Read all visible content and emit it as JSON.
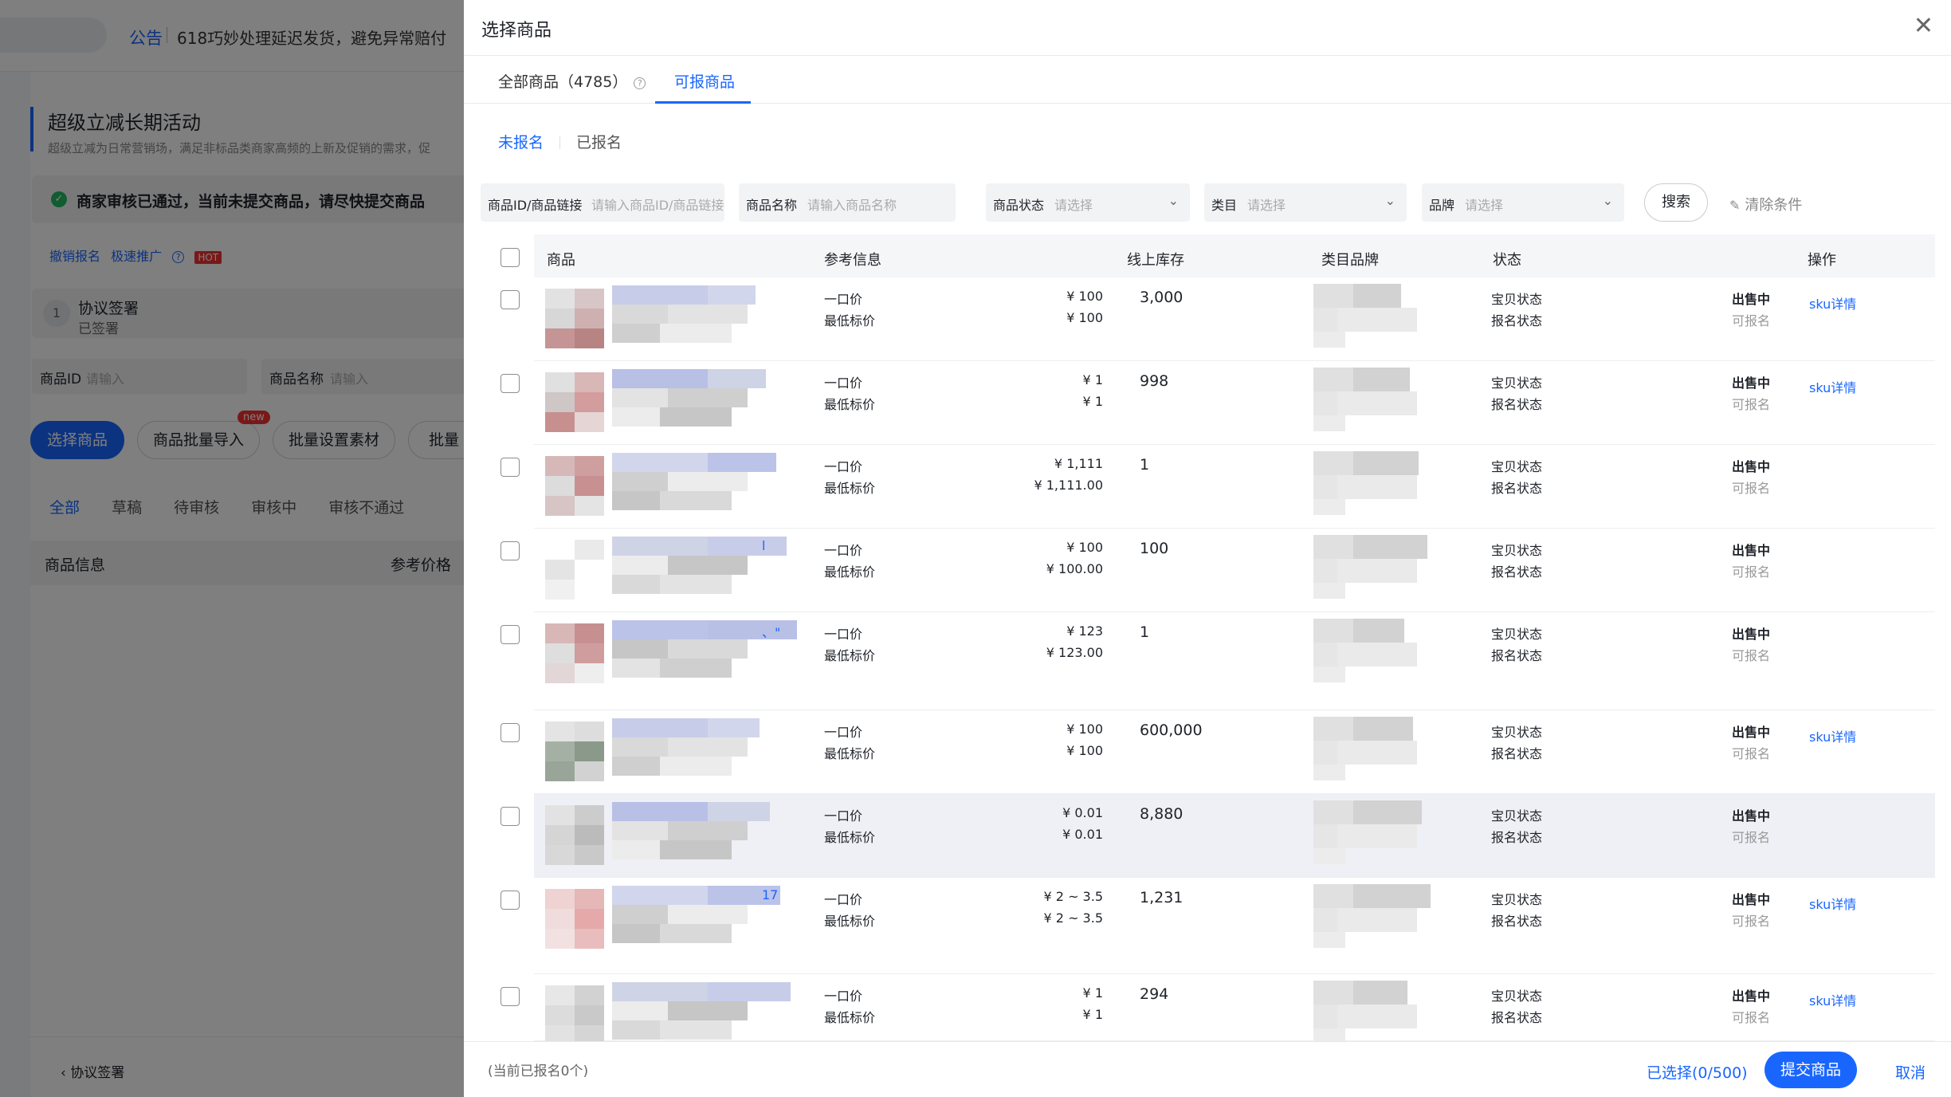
{
  "background": {
    "notice_tag": "公告",
    "notice_text": "618巧妙处理延迟发货，避免异常赔付",
    "activity_title": "超级立减长期活动",
    "activity_desc": "超级立减为日常营销场，满足非标品类商家高频的上新及促销的需求，促",
    "status_text": "商家审核已通过，当前未提交商品，请尽快提交商品",
    "links": [
      "撤销报名",
      "极速推广"
    ],
    "hot_badge": "HOT",
    "step": {
      "num": "1",
      "title": "协议签署",
      "subtitle": "已签署"
    },
    "fields": [
      {
        "label": "商品ID",
        "placeholder": "请输入"
      },
      {
        "label": "商品名称",
        "placeholder": "请输入"
      }
    ],
    "buttons": [
      "选择商品",
      "商品批量导入",
      "批量设置素材",
      "批量"
    ],
    "new_badge": "new",
    "tabs": [
      "全部",
      "草稿",
      "待审核",
      "审核中",
      "审核不通过"
    ],
    "table_headers": [
      "商品信息",
      "参考价格"
    ],
    "footer_back": "协议签署"
  },
  "drawer": {
    "title": "选择商品",
    "tabs": [
      {
        "label": "全部商品（4785）",
        "active": false
      },
      {
        "label": "可报商品",
        "active": true
      }
    ],
    "subtabs": [
      {
        "label": "未报名",
        "active": true
      },
      {
        "label": "已报名",
        "active": false
      }
    ],
    "filters": [
      {
        "label": "商品ID/商品链接",
        "placeholder": "请输入商品ID/商品链接"
      },
      {
        "label": "商品名称",
        "placeholder": "请输入商品名称"
      },
      {
        "label": "商品状态",
        "placeholder": "请选择"
      },
      {
        "label": "类目",
        "placeholder": "请选择"
      },
      {
        "label": "品牌",
        "placeholder": "请选择"
      }
    ],
    "search_label": "搜索",
    "clear_label": "清除条件",
    "columns": [
      "商品",
      "参考信息",
      "线上库存",
      "类目品牌",
      "状态",
      "操作"
    ],
    "price_label": "一口价",
    "lowest_label": "最低标价",
    "status_label_1": "宝贝状态",
    "status_label_2": "报名状态",
    "rows": [
      {
        "price": "¥ 100",
        "lowest": "¥ 100",
        "stock": "3,000",
        "status1": "出售中",
        "status2": "可报名",
        "op": "sku详情"
      },
      {
        "price": "¥ 1",
        "lowest": "¥ 1",
        "stock": "998",
        "status1": "出售中",
        "status2": "可报名",
        "op": "sku详情"
      },
      {
        "price": "¥ 1,111",
        "lowest": "¥ 1,111.00",
        "stock": "1",
        "status1": "出售中",
        "status2": "可报名",
        "op": ""
      },
      {
        "price": "¥ 100",
        "lowest": "¥ 100.00",
        "stock": "100",
        "status1": "出售中",
        "status2": "可报名",
        "op": "",
        "name_fragment": "l"
      },
      {
        "price": "¥ 123",
        "lowest": "¥ 123.00",
        "stock": "1",
        "status1": "出售中",
        "status2": "可报名",
        "op": "",
        "name_fragment": "、\""
      },
      {
        "price": "¥ 100",
        "lowest": "¥ 100",
        "stock": "600,000",
        "status1": "出售中",
        "status2": "可报名",
        "op": "sku详情"
      },
      {
        "price": "¥ 0.01",
        "lowest": "¥ 0.01",
        "stock": "8,880",
        "status1": "出售中",
        "status2": "可报名",
        "op": ""
      },
      {
        "price": "¥ 2 ~ 3.5",
        "lowest": "¥ 2 ~ 3.5",
        "stock": "1,231",
        "status1": "出售中",
        "status2": "可报名",
        "op": "sku详情",
        "name_fragment": "17"
      },
      {
        "price": "¥ 1",
        "lowest": "¥ 1",
        "stock": "294",
        "status1": "出售中",
        "status2": "可报名",
        "op": "sku详情"
      }
    ],
    "footer_note": "(当前已报名0个)",
    "selected_text": "已选择(0/500)",
    "submit_label": "提交商品",
    "cancel_label": "取消"
  },
  "colors": {
    "accent": "#1966ff",
    "success": "#25b865",
    "hot": "#f23030"
  }
}
